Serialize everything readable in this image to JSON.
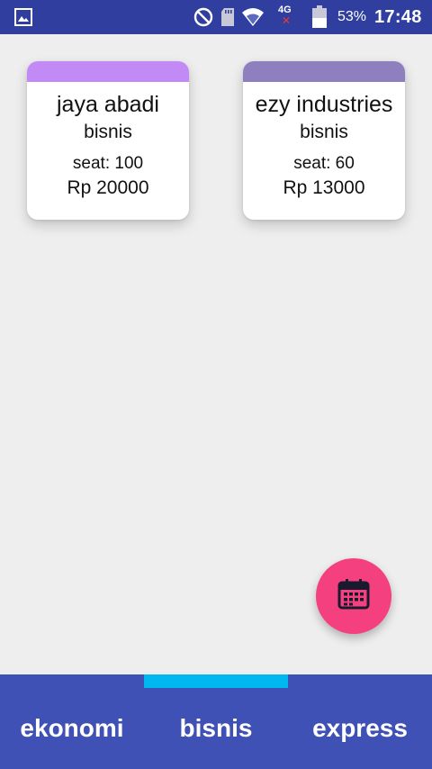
{
  "status_bar": {
    "network_label": "4G",
    "battery_percent": "53%",
    "time": "17:48",
    "icons": [
      "gallery-icon",
      "do-not-disturb-icon",
      "sd-card-icon",
      "wifi-icon",
      "network-icon",
      "battery-icon"
    ]
  },
  "cards": [
    {
      "name": "jaya abadi",
      "class": "bisnis",
      "seat": "seat: 100",
      "price": "Rp 20000",
      "header_color": "#c28af4"
    },
    {
      "name": "ezy industries",
      "class": "bisnis",
      "seat": "seat: 60",
      "price": "Rp 13000",
      "header_color": "#8e80bf"
    }
  ],
  "fab": {
    "icon": "calendar-icon",
    "color": "#f4407e"
  },
  "tabs": [
    {
      "label": "ekonomi"
    },
    {
      "label": "bisnis"
    },
    {
      "label": "express"
    }
  ],
  "selected_tab": "bisnis",
  "colors": {
    "status_bar": "#303f9f",
    "tab_bar": "#3f51b5",
    "tab_indicator": "#00b8f0",
    "background": "#eeeeee"
  }
}
